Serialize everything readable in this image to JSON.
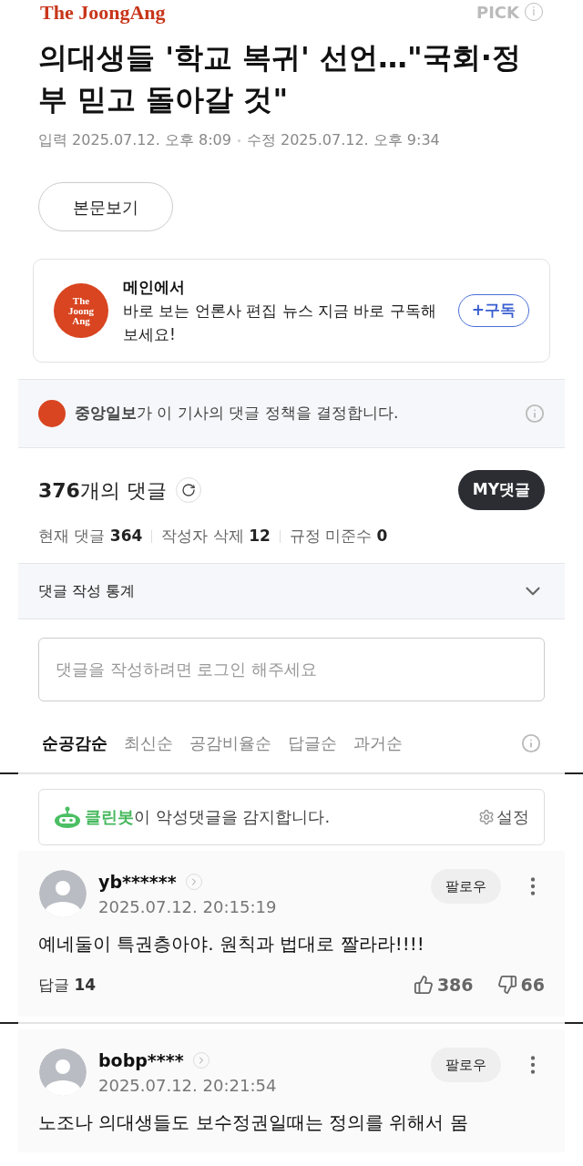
{
  "header": {
    "logo": "The JoongAng",
    "pick": "PICK",
    "pick_icon": "i"
  },
  "article": {
    "title": "의대생들 '학교 복귀' 선언…\"국회·정부 믿고 돌아갈 것\"",
    "input_label": "입력",
    "input_date": "2025.07.12. 오후 8:09",
    "edit_label": "수정",
    "edit_date": "2025.07.12. 오후 9:34",
    "body_button": "본문보기"
  },
  "subscribe": {
    "logo_lines": [
      "The",
      "Joong",
      "Ang"
    ],
    "title": "메인에서",
    "text": "바로 보는 언론사 편집 뉴스 지금 바로 구독해보세요!",
    "button": "+구독"
  },
  "policy": {
    "text": "**중앙일보**가 이 기사의 댓글 정책을 결정합니다."
  },
  "comments": {
    "count": "376",
    "count_suffix": "개의 댓글",
    "my_button": "MY댓글",
    "stats": [
      {
        "label": "현재 댓글",
        "value": "364"
      },
      {
        "label": "작성자 삭제",
        "value": "12"
      },
      {
        "label": "규정 미준수",
        "value": "0"
      }
    ],
    "stats_toggle": {
      "label": "댓글 작성 통계",
      "expanded": false
    },
    "input": {
      "placeholder": "댓글을 작성하려면 로그인 해주세요"
    },
    "sort_tabs": [
      {
        "label": "순공감순",
        "selected": true
      },
      {
        "label": "최신순",
        "selected": false
      },
      {
        "label": "공감비율순",
        "selected": false
      },
      {
        "label": "답글순",
        "selected": false
      },
      {
        "label": "과거순",
        "selected": false
      }
    ],
    "cleanbot": {
      "name": "클린봇",
      "text": "이 악성댓글을 감지합니다.",
      "settings": "설정"
    },
    "items": [
      {
        "user": "yb******",
        "time": "2025.07.12. 20:15:19",
        "follow": "팔로우",
        "text": "예네둘이 특권층아야. 원칙과 법대로 짤라라!!!!",
        "reply_label": "답글",
        "replies": "14",
        "likes": "386",
        "dislikes": "66"
      },
      {
        "user": "bobp****",
        "time": "2025.07.12. 20:21:54",
        "follow": "팔로우",
        "text": "노조나 의대생들도 보수정권일때는 정의를 위해서 몸"
      }
    ]
  }
}
